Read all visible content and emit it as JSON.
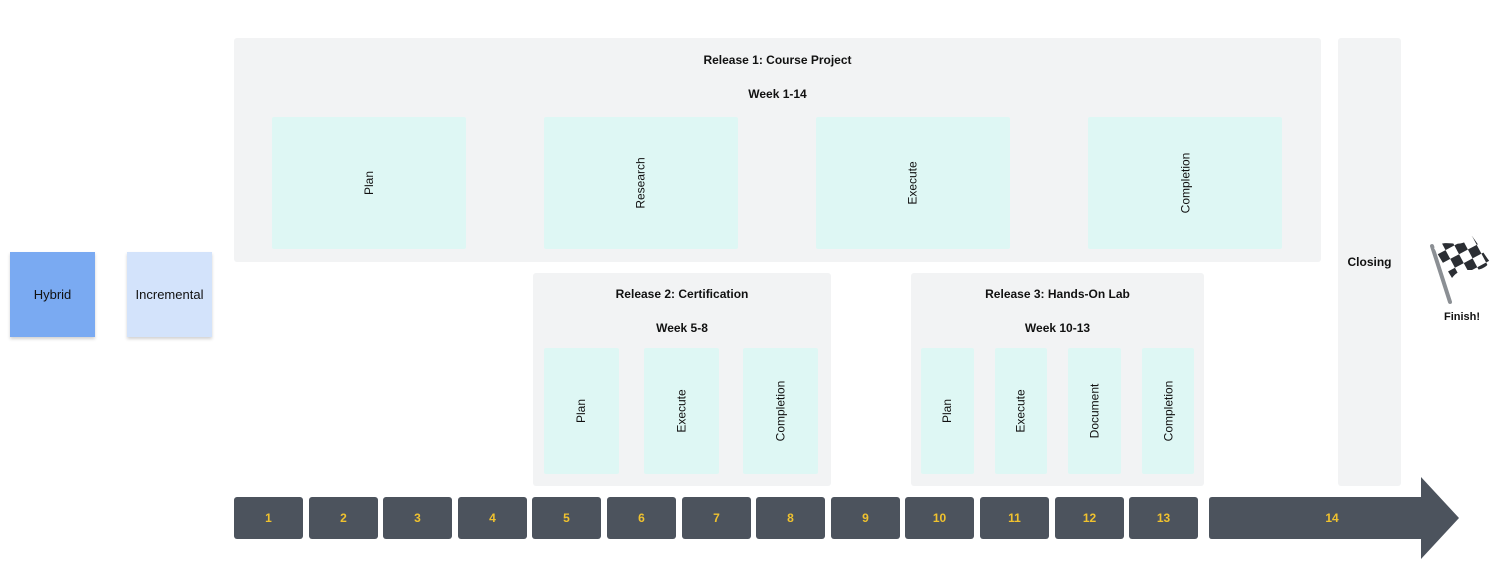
{
  "stickies": {
    "hybrid": "Hybrid",
    "incremental": "Incremental"
  },
  "release1": {
    "title": "Release 1: Course Project",
    "weeks": "Week 1-14",
    "phases": [
      "Plan",
      "Research",
      "Execute",
      "Completion"
    ]
  },
  "release2": {
    "title": "Release 2: Certification",
    "weeks": "Week 5-8",
    "phases": [
      "Plan",
      "Execute",
      "Completion"
    ]
  },
  "release3": {
    "title": "Release 3: Hands-On Lab",
    "weeks": "Week 10-13",
    "phases": [
      "Plan",
      "Execute",
      "Document",
      "Completion"
    ]
  },
  "closing": "Closing",
  "finish": {
    "label": "Finish!",
    "icon": "checkered-flag-icon"
  },
  "timeline": {
    "weeks": [
      "1",
      "2",
      "3",
      "4",
      "5",
      "6",
      "7",
      "8",
      "9",
      "10",
      "11",
      "12",
      "13",
      "14"
    ]
  },
  "colors": {
    "hybrid": "#7aaaf2",
    "incremental": "#d3e3fb",
    "panel": "#f2f3f4",
    "phase": "#def7f4",
    "timeline": "#4c535d",
    "week_number": "#f0c22e"
  }
}
